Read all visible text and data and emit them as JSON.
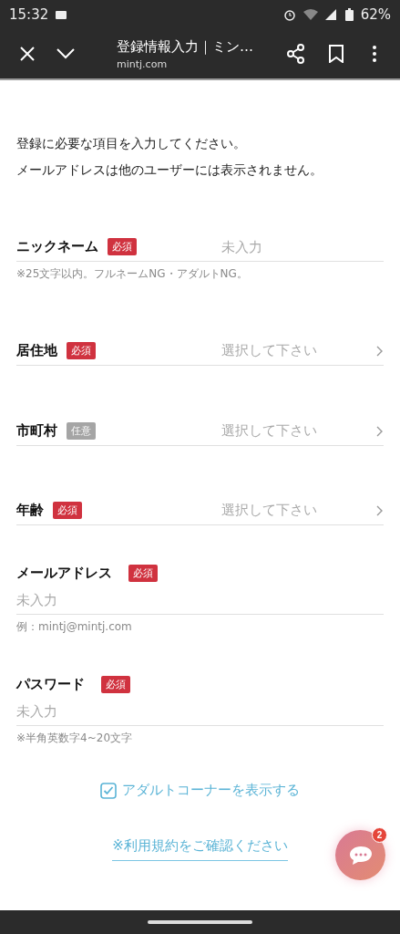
{
  "status_bar": {
    "time": "15:32",
    "battery": "62%"
  },
  "browser": {
    "title": "登録情報入力｜ミン…",
    "url": "mintj.com"
  },
  "intro": [
    "登録に必要な項目を入力してください。",
    "メールアドレスは他のユーザーには表示されません。"
  ],
  "fields": [
    {
      "kind": "inline",
      "label": "ニックネーム",
      "badge": "必須",
      "required": true,
      "placeholder": "未入力",
      "hint": "※25文字以内。フルネームNG・アダルトNG。"
    },
    {
      "kind": "select",
      "label": "居住地",
      "badge": "必須",
      "required": true,
      "value": "選択して下さい"
    },
    {
      "kind": "select",
      "label": "市町村",
      "badge": "任意",
      "required": false,
      "value": "選択して下さい"
    },
    {
      "kind": "select",
      "label": "年齢",
      "badge": "必須",
      "required": true,
      "value": "選択して下さい"
    },
    {
      "kind": "stacked",
      "label": "メールアドレス",
      "badge": "必須",
      "required": true,
      "placeholder": "未入力",
      "hint": "例：mintj@mintj.com"
    },
    {
      "kind": "stacked",
      "label": "パスワード",
      "badge": "必須",
      "required": true,
      "placeholder": "未入力",
      "hint": "※半角英数字4~20文字"
    }
  ],
  "adult_option": {
    "label": "アダルトコーナーを表示する",
    "checked": true
  },
  "terms_link": "※利用規約をご確認ください",
  "chat": {
    "badge": "2"
  }
}
